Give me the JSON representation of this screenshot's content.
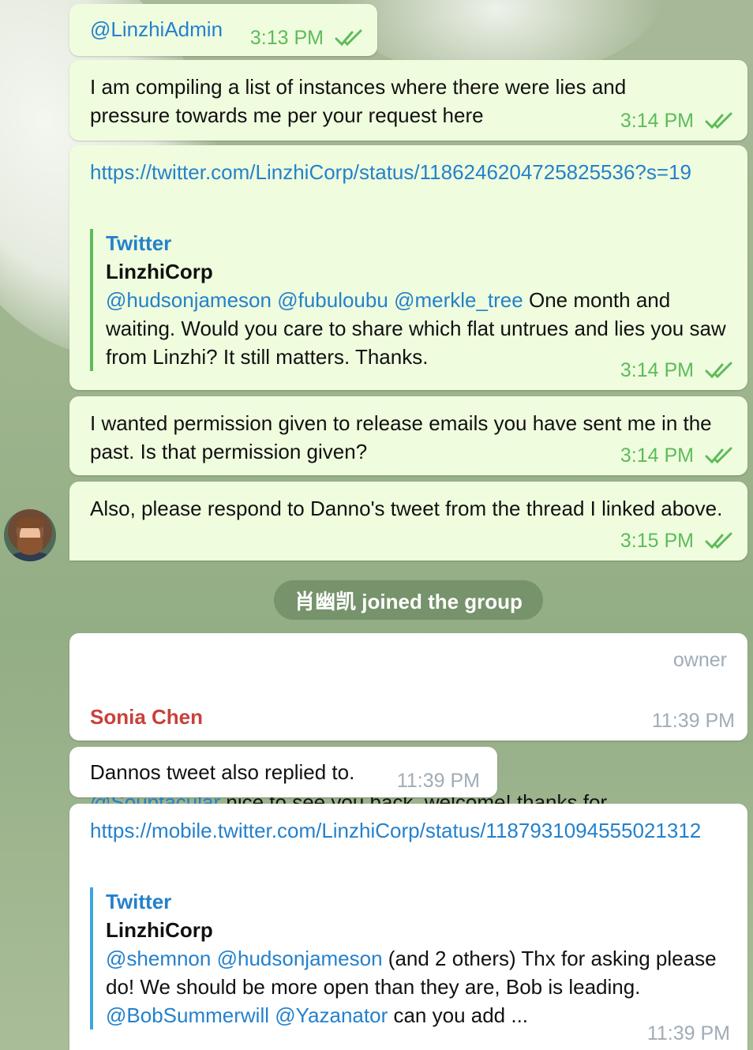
{
  "messages": [
    {
      "text": "@LinzhiAdmin",
      "time": "3:13 PM"
    },
    {
      "text": "I am compiling a list of instances where there were lies and pressure towards me per your request here",
      "time": "3:14 PM"
    },
    {
      "link": "https://twitter.com/LinzhiCorp/status/1186246204725825536?s=19",
      "preview": {
        "site": "Twitter",
        "author": "LinzhiCorp",
        "mentions": [
          "@hudsonjameson",
          "@fubuloubu",
          "@merkle_tree"
        ],
        "body": "One month and waiting. Would you care to share which flat untrues and lies you saw from Linzhi? It still matters. Thanks."
      },
      "time": "3:14 PM"
    },
    {
      "text": "I wanted permission given to release emails you have sent me in the past. Is that permission given?",
      "time": "3:14 PM"
    },
    {
      "text": "Also, please respond to Danno's tweet from the thread I linked above.",
      "time": "3:15 PM"
    }
  ],
  "service_message": "肖幽凯 joined the group",
  "incoming": [
    {
      "sender": "Sonia Chen",
      "role": "owner",
      "mention": "@Souptacular",
      "text": "nice to see you back, welcome! thanks for asking and yes please do and wonderful you make the effort.",
      "time": "11:39 PM"
    },
    {
      "text": "Dannos tweet also replied to.",
      "time": "11:39 PM"
    },
    {
      "link": "https://mobile.twitter.com/LinzhiCorp/status/1187931094555021312",
      "preview": {
        "site": "Twitter",
        "author": "LinzhiCorp",
        "mentions": [
          "@shemnon",
          "@hudsonjameson"
        ],
        "body_1": "(and 2 others) Thx for asking please do! We should be more open than they are, Bob is leading.",
        "mentions_2": [
          "@BobSummerwill",
          "@Yazanator"
        ],
        "body_2": "can you add ..."
      },
      "time": "11:39 PM"
    }
  ],
  "colors": {
    "outgoing": "#effdde",
    "incoming": "#ffffff",
    "check": "#5dbb5b",
    "link": "#2481cc",
    "sender": "#c9403a"
  }
}
